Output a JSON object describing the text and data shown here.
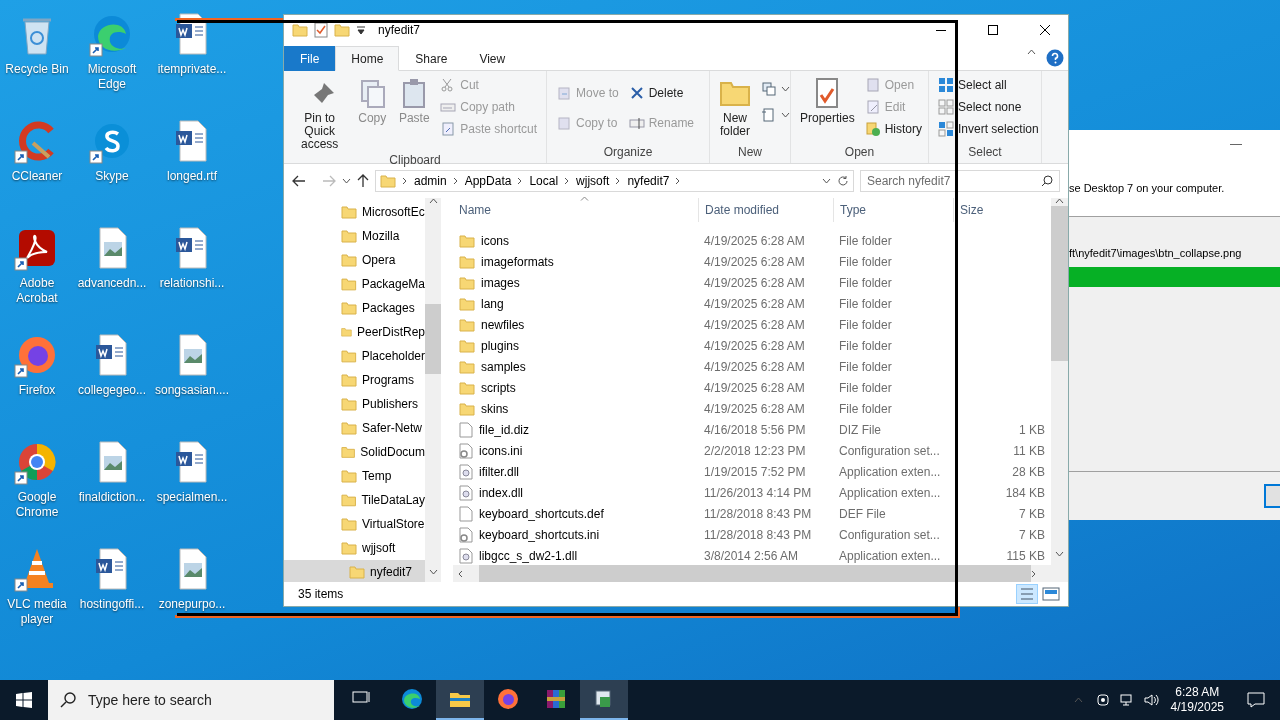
{
  "desktop_icons": [
    {
      "label": "Recycle Bin",
      "shortcut": false
    },
    {
      "label": "CCleaner",
      "shortcut": true
    },
    {
      "label": "Adobe Acrobat",
      "shortcut": true
    },
    {
      "label": "Firefox",
      "shortcut": true
    },
    {
      "label": "Google Chrome",
      "shortcut": true
    },
    {
      "label": "VLC media player",
      "shortcut": true
    },
    {
      "label": "Microsoft Edge",
      "shortcut": true
    },
    {
      "label": "Skype",
      "shortcut": true
    },
    {
      "label": "advancedn...",
      "shortcut": false
    },
    {
      "label": "collegegeo...",
      "shortcut": false
    },
    {
      "label": "finaldiction...",
      "shortcut": false
    },
    {
      "label": "hostingoffi...",
      "shortcut": false
    },
    {
      "label": "itemprivate...",
      "shortcut": false
    },
    {
      "label": "longed.rtf",
      "shortcut": false
    },
    {
      "label": "relationshi...",
      "shortcut": false
    },
    {
      "label": "songsasian....",
      "shortcut": false
    },
    {
      "label": "specialmen...",
      "shortcut": false
    },
    {
      "label": "zonepurpo...",
      "shortcut": false
    }
  ],
  "installer": {
    "message": "se Desktop 7 on your computer.",
    "current_file": "ft\\nyfedit7\\images\\btn_collapse.png",
    "progress": {
      "level": 1
    }
  },
  "explorer": {
    "title": "nyfedit7",
    "tabs": [
      {
        "label": "File",
        "kind": "file"
      },
      {
        "label": "Home",
        "selected": true
      },
      {
        "label": "Share",
        "selected": false
      },
      {
        "label": "View",
        "selected": false
      }
    ],
    "ribbon": [
      {
        "label": "Clipboard",
        "items": [
          {
            "label": "Pin to Quick access",
            "kind": "large",
            "disabled": false
          },
          {
            "label": "Copy",
            "kind": "large",
            "disabled": true
          },
          {
            "label": "Paste",
            "kind": "large",
            "disabled": true
          },
          {
            "label": "Cut",
            "kind": "small",
            "disabled": true
          },
          {
            "label": "Copy path",
            "kind": "small",
            "disabled": true
          },
          {
            "label": "Paste shortcut",
            "kind": "small",
            "disabled": true
          }
        ]
      },
      {
        "label": "Organize",
        "items": [
          {
            "label": "Move to",
            "kind": "small",
            "disabled": true
          },
          {
            "label": "Copy to",
            "kind": "small",
            "disabled": true
          },
          {
            "label": "Delete",
            "kind": "small",
            "disabled": false
          },
          {
            "label": "Rename",
            "kind": "small",
            "disabled": true
          }
        ]
      },
      {
        "label": "New",
        "items": [
          {
            "label": "New folder",
            "kind": "large",
            "disabled": false
          },
          {
            "kind": "icon",
            "disabled": false
          },
          {
            "kind": "icon",
            "disabled": false
          }
        ]
      },
      {
        "label": "Open",
        "items": [
          {
            "label": "Properties",
            "kind": "large",
            "disabled": false
          },
          {
            "label": "Open",
            "kind": "small",
            "disabled": true
          },
          {
            "label": "Edit",
            "kind": "small",
            "disabled": true
          },
          {
            "label": "History",
            "kind": "small",
            "disabled": false
          }
        ]
      },
      {
        "label": "Select",
        "items": [
          {
            "label": "Select all",
            "kind": "small",
            "disabled": false
          },
          {
            "label": "Select none",
            "kind": "small",
            "disabled": false
          },
          {
            "label": "Invert selection",
            "kind": "small",
            "disabled": false
          }
        ]
      }
    ],
    "address": [
      "admin",
      "AppData",
      "Local",
      "wjjsoft",
      "nyfedit7"
    ],
    "search": {
      "placeholder": "Search nyfedit7"
    },
    "nav_tree": [
      {
        "label": "MicrosoftEc",
        "selected": false
      },
      {
        "label": "Mozilla",
        "selected": false
      },
      {
        "label": "Opera",
        "selected": false
      },
      {
        "label": "PackageMa",
        "selected": false
      },
      {
        "label": "Packages",
        "selected": false
      },
      {
        "label": "PeerDistRep",
        "selected": false
      },
      {
        "label": "Placeholder",
        "selected": false
      },
      {
        "label": "Programs",
        "selected": false
      },
      {
        "label": "Publishers",
        "selected": false
      },
      {
        "label": "Safer-Netw",
        "selected": false
      },
      {
        "label": "SolidDocum",
        "selected": false
      },
      {
        "label": "Temp",
        "selected": false
      },
      {
        "label": "TileDataLay",
        "selected": false
      },
      {
        "label": "VirtualStore",
        "selected": false
      },
      {
        "label": "wjjsoft",
        "selected": false,
        "children": [
          {
            "label": "nyfedit7",
            "selected": true
          }
        ]
      }
    ],
    "columns": [
      "Name",
      "Date modified",
      "Type",
      "Size"
    ],
    "rows": [
      {
        "kind": "folder",
        "name": "icons",
        "date": "4/19/2025 6:28 AM",
        "type": "File folder"
      },
      {
        "kind": "folder",
        "name": "imageformats",
        "date": "4/19/2025 6:28 AM",
        "type": "File folder"
      },
      {
        "kind": "folder",
        "name": "images",
        "date": "4/19/2025 6:28 AM",
        "type": "File folder"
      },
      {
        "kind": "folder",
        "name": "lang",
        "date": "4/19/2025 6:28 AM",
        "type": "File folder"
      },
      {
        "kind": "folder",
        "name": "newfiles",
        "date": "4/19/2025 6:28 AM",
        "type": "File folder"
      },
      {
        "kind": "folder",
        "name": "plugins",
        "date": "4/19/2025 6:28 AM",
        "type": "File folder"
      },
      {
        "kind": "folder",
        "name": "samples",
        "date": "4/19/2025 6:28 AM",
        "type": "File folder"
      },
      {
        "kind": "folder",
        "name": "scripts",
        "date": "4/19/2025 6:28 AM",
        "type": "File folder"
      },
      {
        "kind": "folder",
        "name": "skins",
        "date": "4/19/2025 6:28 AM",
        "type": "File folder"
      },
      {
        "kind": "document",
        "name": "file_id.diz",
        "date": "4/16/2018 5:56 PM",
        "type": "DIZ File",
        "size": "1 KB"
      },
      {
        "kind": "config",
        "name": "icons.ini",
        "date": "2/2/2018 12:23 PM",
        "type": "Configuration set...",
        "size": "11 KB"
      },
      {
        "kind": "library",
        "name": "ifilter.dll",
        "date": "1/19/2015 7:52 PM",
        "type": "Application exten...",
        "size": "28 KB"
      },
      {
        "kind": "library",
        "name": "index.dll",
        "date": "11/26/2013 4:14 PM",
        "type": "Application exten...",
        "size": "184 KB"
      },
      {
        "kind": "document",
        "name": "keyboard_shortcuts.def",
        "date": "11/28/2018 8:43 PM",
        "type": "DEF File",
        "size": "7 KB"
      },
      {
        "kind": "config",
        "name": "keyboard_shortcuts.ini",
        "date": "11/28/2018 8:43 PM",
        "type": "Configuration set...",
        "size": "7 KB"
      },
      {
        "kind": "library",
        "name": "libgcc_s_dw2-1.dll",
        "date": "3/8/2014 2:56 AM",
        "type": "Application exten...",
        "size": "115 KB"
      }
    ],
    "status": "35 items"
  },
  "taskbar": {
    "search_placeholder": "Type here to search",
    "apps": [
      {
        "active": false
      },
      {
        "active": false
      },
      {
        "active": true
      },
      {
        "active": false
      },
      {
        "active": false
      },
      {
        "active": true
      }
    ],
    "time": "6:28 AM",
    "date": "4/19/2025"
  }
}
